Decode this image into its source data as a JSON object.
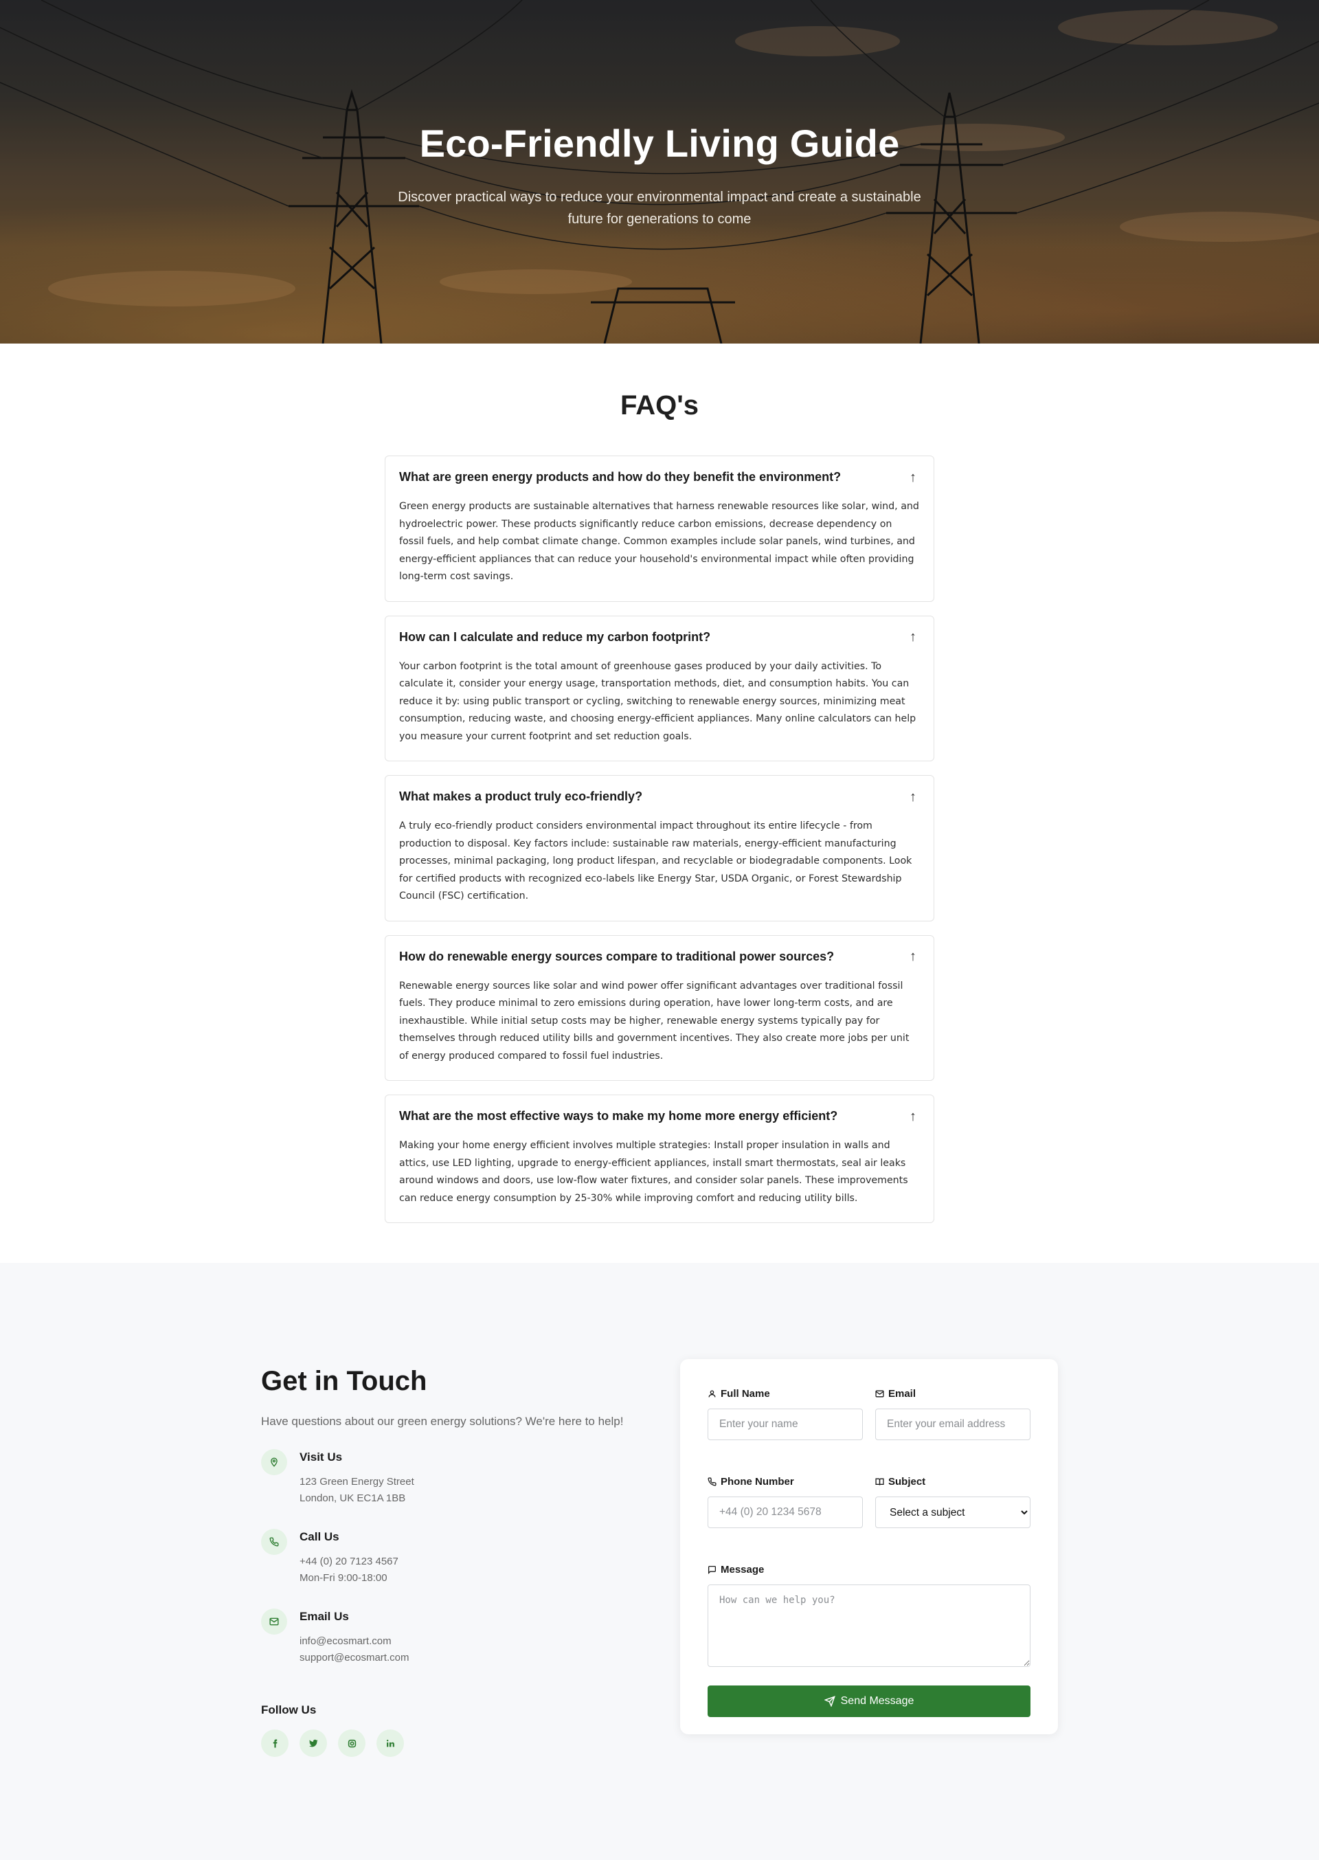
{
  "hero": {
    "title": "Eco-Friendly Living Guide",
    "subtitle": "Discover practical ways to reduce your environmental impact and create a sustainable future for generations to come"
  },
  "faq": {
    "title": "FAQ's",
    "toggle_icon": "↑",
    "items": [
      {
        "question": "What are green energy products and how do they benefit the environment?",
        "answer": "Green energy products are sustainable alternatives that harness renewable resources like solar, wind, and hydroelectric power. These products significantly reduce carbon emissions, decrease dependency on fossil fuels, and help combat climate change. Common examples include solar panels, wind turbines, and energy-efficient appliances that can reduce your household's environmental impact while often providing long-term cost savings."
      },
      {
        "question": "How can I calculate and reduce my carbon footprint?",
        "answer": "Your carbon footprint is the total amount of greenhouse gases produced by your daily activities. To calculate it, consider your energy usage, transportation methods, diet, and consumption habits. You can reduce it by: using public transport or cycling, switching to renewable energy sources, minimizing meat consumption, reducing waste, and choosing energy-efficient appliances. Many online calculators can help you measure your current footprint and set reduction goals."
      },
      {
        "question": "What makes a product truly eco-friendly?",
        "answer": "A truly eco-friendly product considers environmental impact throughout its entire lifecycle - from production to disposal. Key factors include: sustainable raw materials, energy-efficient manufacturing processes, minimal packaging, long product lifespan, and recyclable or biodegradable components. Look for certified products with recognized eco-labels like Energy Star, USDA Organic, or Forest Stewardship Council (FSC) certification."
      },
      {
        "question": "How do renewable energy sources compare to traditional power sources?",
        "answer": "Renewable energy sources like solar and wind power offer significant advantages over traditional fossil fuels. They produce minimal to zero emissions during operation, have lower long-term costs, and are inexhaustible. While initial setup costs may be higher, renewable energy systems typically pay for themselves through reduced utility bills and government incentives. They also create more jobs per unit of energy produced compared to fossil fuel industries."
      },
      {
        "question": "What are the most effective ways to make my home more energy efficient?",
        "answer": "Making your home energy efficient involves multiple strategies: Install proper insulation in walls and attics, use LED lighting, upgrade to energy-efficient appliances, install smart thermostats, seal air leaks around windows and doors, use low-flow water fixtures, and consider solar panels. These improvements can reduce energy consumption by 25-30% while improving comfort and reducing utility bills."
      }
    ]
  },
  "contact": {
    "title": "Get in Touch",
    "subtitle": "Have questions about our green energy solutions? We're here to help!",
    "visit": {
      "title": "Visit Us",
      "line1": "123 Green Energy Street",
      "line2": "London, UK EC1A 1BB",
      "icon": "map-pin-icon"
    },
    "call": {
      "title": "Call Us",
      "line1": "+44 (0) 20 7123 4567",
      "line2": "Mon-Fri 9:00-18:00",
      "icon": "phone-icon"
    },
    "email": {
      "title": "Email Us",
      "line1": "info@ecosmart.com",
      "line2": "support@ecosmart.com",
      "icon": "mail-icon"
    },
    "follow_title": "Follow Us",
    "socials": [
      "facebook-icon",
      "twitter-icon",
      "instagram-icon",
      "linkedin-icon"
    ]
  },
  "form": {
    "name_label": "Full Name",
    "name_placeholder": "Enter your name",
    "email_label": "Email",
    "email_placeholder": "Enter your email address",
    "phone_label": "Phone Number",
    "phone_placeholder": "+44 (0) 20 1234 5678",
    "subject_label": "Subject",
    "subject_selected": "Select a subject",
    "message_label": "Message",
    "message_placeholder": "How can we help you?",
    "submit_label": "Send Message"
  },
  "colors": {
    "accent": "#2e7d32",
    "icon_bg": "#e5f3e6",
    "section_bg": "#f7f8fa"
  }
}
